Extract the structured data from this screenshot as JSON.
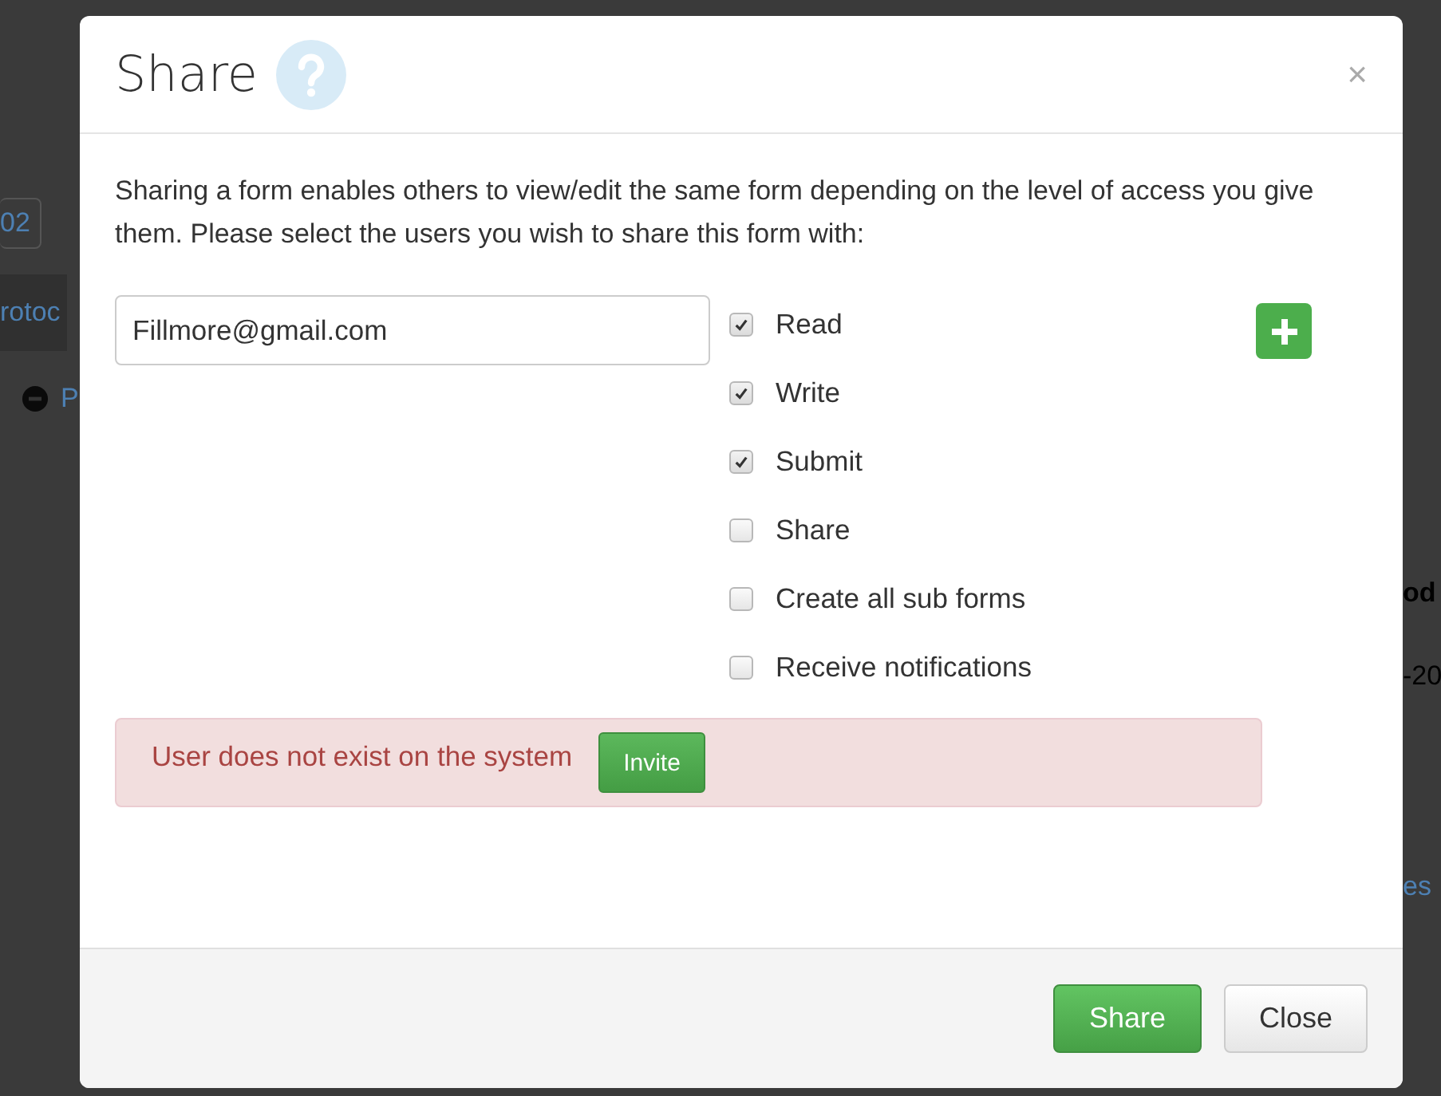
{
  "background": {
    "fragments": [
      {
        "text": "02",
        "kind": "boxed-link"
      },
      {
        "text": "rotoc",
        "kind": "bar-link"
      },
      {
        "text": "P",
        "kind": "icon-link"
      },
      {
        "text": "od",
        "kind": "heading"
      },
      {
        "text": "-20",
        "kind": "plain"
      },
      {
        "text": "es",
        "kind": "link"
      }
    ]
  },
  "dialog": {
    "title": "Share",
    "close": "×",
    "intro": "Sharing a form enables others to view/edit the same form depending on the level of access you give them. Please select the users you wish to share this form with:",
    "email": {
      "value": "Fillmore@gmail.com"
    },
    "permissions": [
      {
        "label": "Read",
        "checked": true
      },
      {
        "label": "Write",
        "checked": true
      },
      {
        "label": "Submit",
        "checked": true
      },
      {
        "label": "Share",
        "checked": false
      },
      {
        "label": "Create all sub forms",
        "checked": false
      },
      {
        "label": "Receive notifications",
        "checked": false
      }
    ],
    "alert": {
      "message": "User does not exist on the system",
      "button": "Invite"
    },
    "buttons": [
      {
        "label": "Share",
        "kind": "primary"
      },
      {
        "label": "Close",
        "kind": "default"
      }
    ]
  }
}
